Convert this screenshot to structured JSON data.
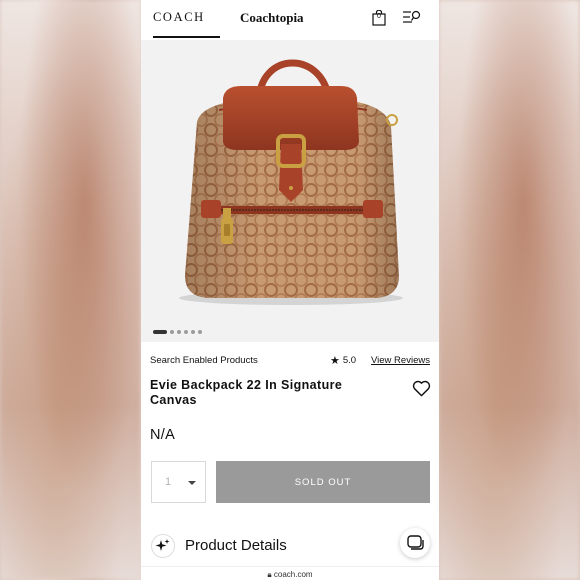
{
  "header": {
    "brand": "COACH",
    "sub_brand": "Coachtopia",
    "bag_count": "0",
    "icons": [
      "shopping-bag-icon",
      "menu-search-icon"
    ]
  },
  "gallery": {
    "image_alt": "Evie Backpack 22 In Signature Canvas",
    "slide_count": 6,
    "active_slide": 1
  },
  "product": {
    "tag": "Search Enabled Products",
    "rating": "5.0",
    "reviews_link": "View Reviews",
    "title": "Evie Backpack 22 In Signature Canvas",
    "price": "N/A",
    "quantity": "1",
    "cta": "SOLD OUT"
  },
  "details": {
    "label": "Product Details"
  },
  "browser": {
    "url": "coach.com"
  },
  "colors": {
    "canvas_tan": "#c89a72",
    "leather_red": "#a8432a",
    "brass": "#c9a042",
    "button_gray": "#9a9a9a"
  }
}
